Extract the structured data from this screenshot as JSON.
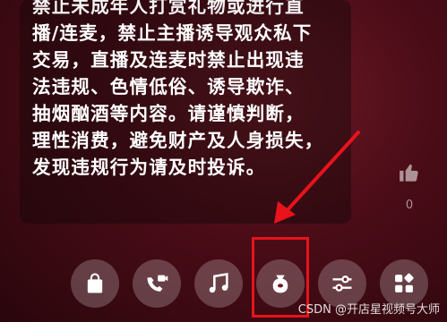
{
  "notice": {
    "lines": [
      "禁止未成年人打赏礼物或进行直",
      "播/连麦，禁止主播诱导观众私下",
      "交易，直播及连麦时禁止出现违",
      "法违规、色情低俗、诱导欺诈、",
      "抽烟酗酒等内容。请谨慎判断，",
      "理性消费，避免财产及人身损失，",
      "发现违规行为请及时投诉。"
    ]
  },
  "like": {
    "icon": "thumbs-up-icon",
    "count": "0"
  },
  "toolbar": {
    "buttons": [
      {
        "name": "shop-button",
        "icon": "shopping-bag-icon"
      },
      {
        "name": "video-call-button",
        "icon": "video-call-icon"
      },
      {
        "name": "music-button",
        "icon": "music-note-icon"
      },
      {
        "name": "gift-button",
        "icon": "lucky-bag-icon"
      },
      {
        "name": "settings-button",
        "icon": "sliders-icon"
      },
      {
        "name": "more-button",
        "icon": "apps-icon"
      }
    ]
  },
  "annotation": {
    "color": "#e8131b"
  },
  "watermark": "CSDN @开店星视频号大师"
}
